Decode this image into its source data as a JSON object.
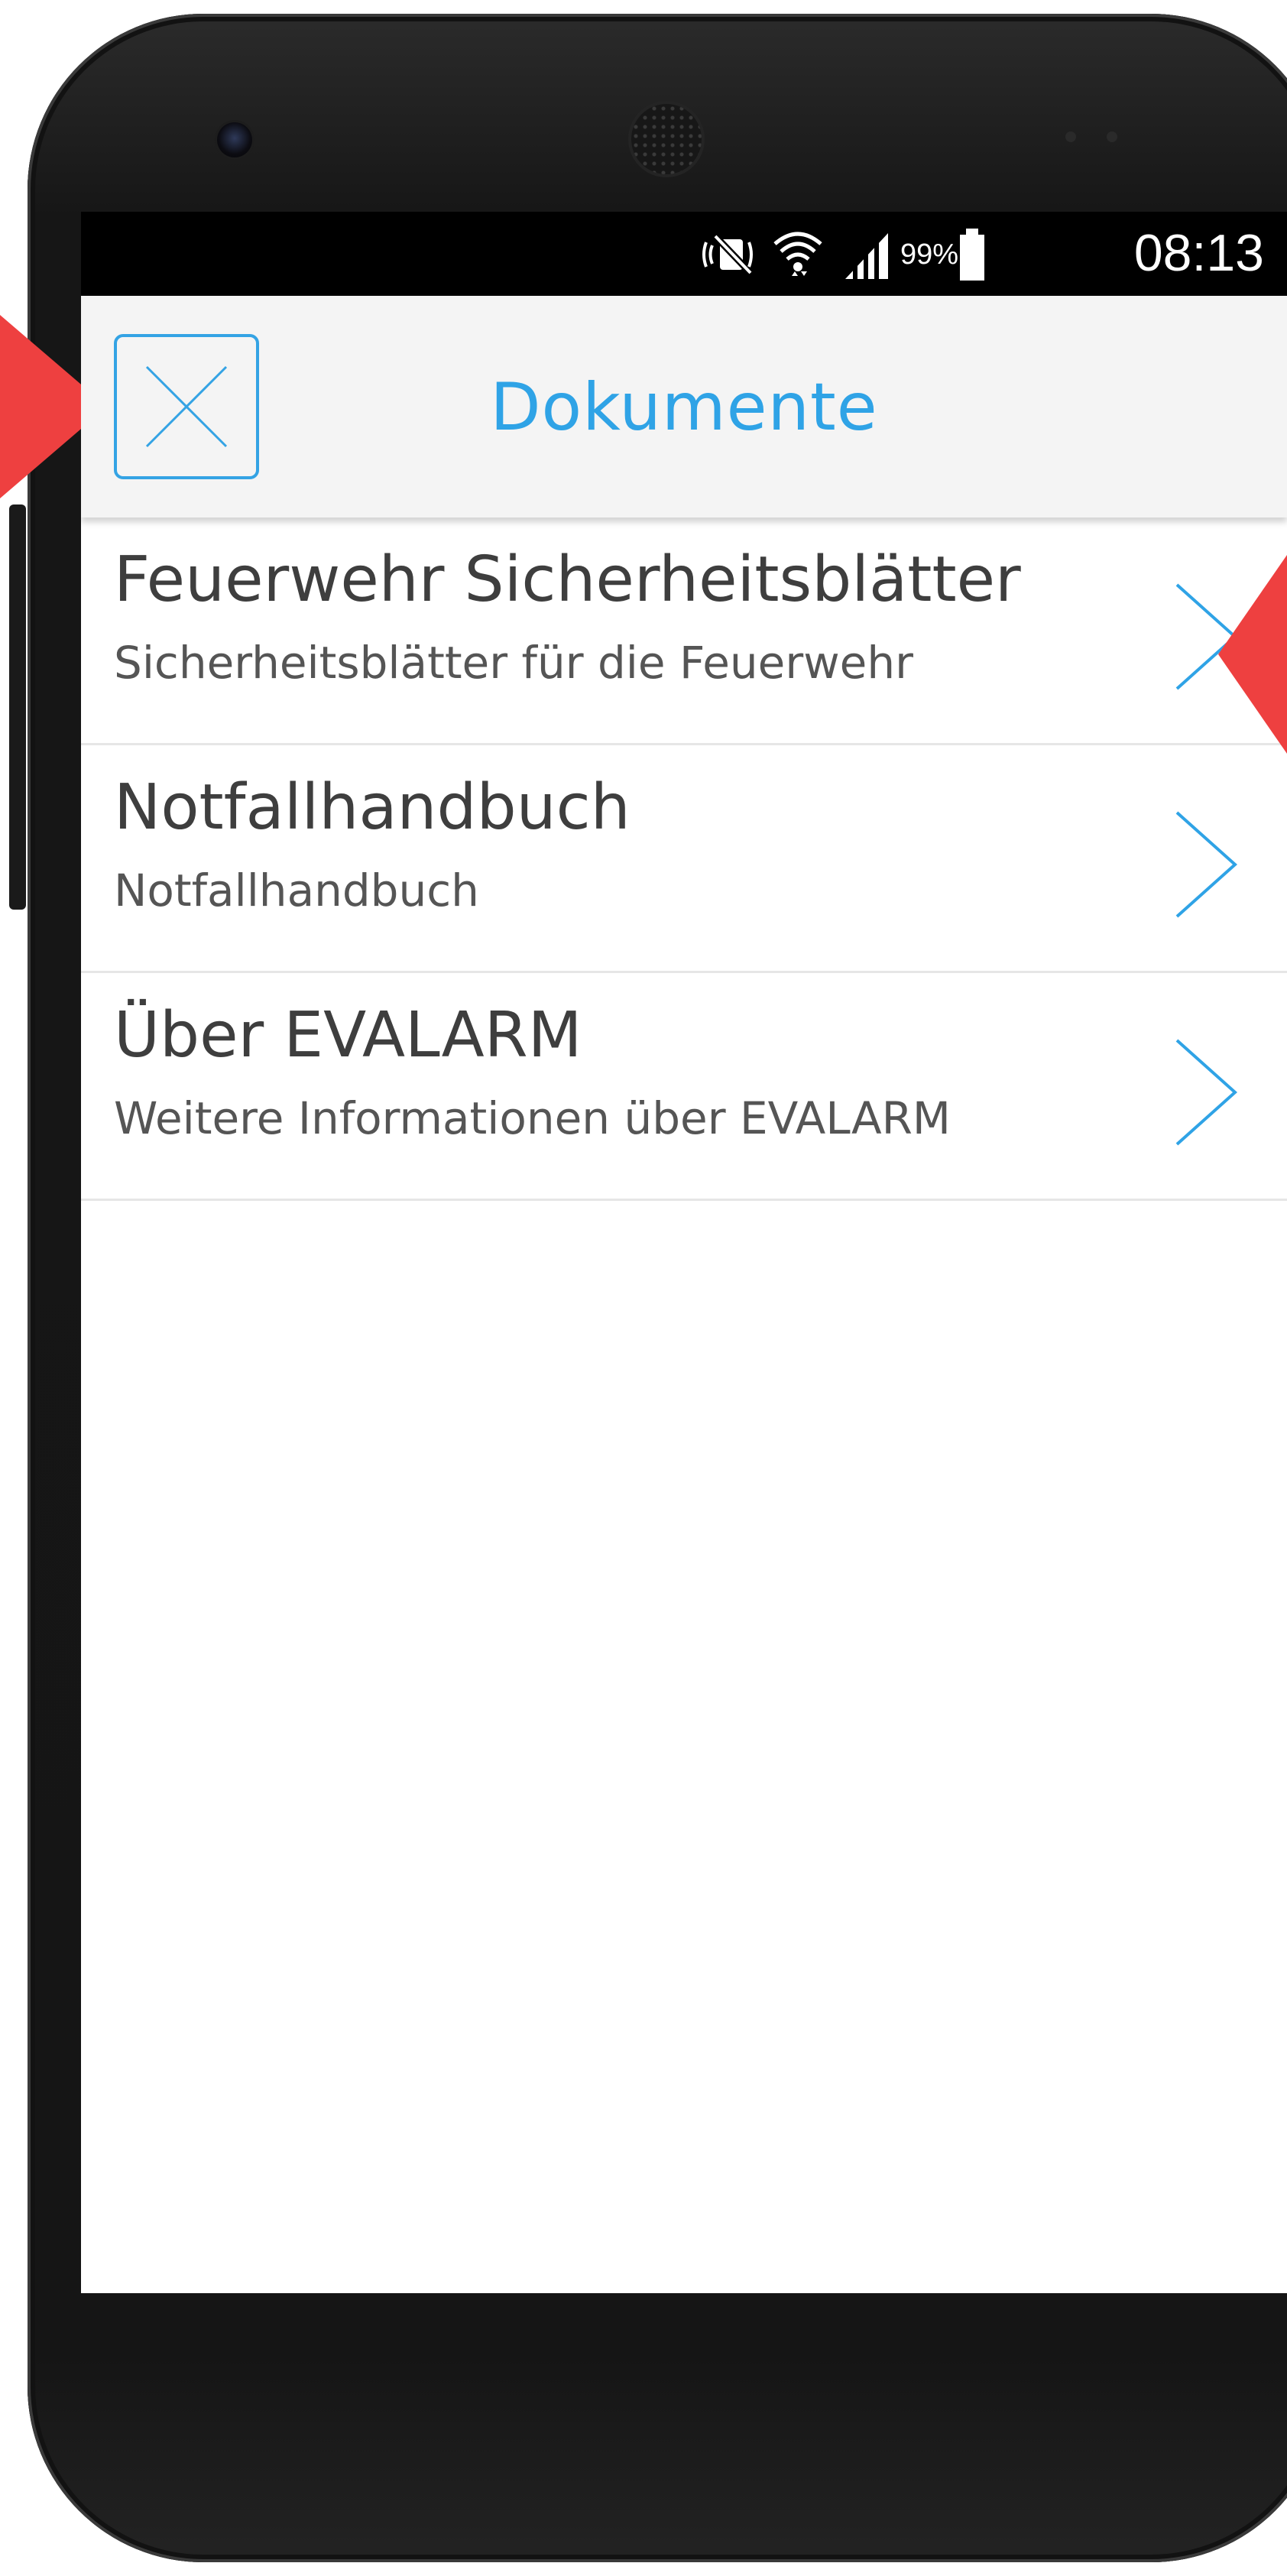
{
  "status_bar": {
    "battery_percent": "99%",
    "time": "08:13",
    "icons": [
      "silent-mode-icon",
      "wifi-icon",
      "signal-icon",
      "battery-icon"
    ]
  },
  "app_bar": {
    "title": "Dokumente",
    "close_icon": "close-icon",
    "accent_color": "#2fa3e6"
  },
  "items": [
    {
      "title": "Feuerwehr Sicherheitsblätter",
      "subtitle": "Sicherheitsblätter für die Feuerwehr"
    },
    {
      "title": "Notfallhandbuch",
      "subtitle": "Notfallhandbuch"
    },
    {
      "title": "Über EVALARM",
      "subtitle": "Weitere Informationen über EVALARM"
    }
  ],
  "annotation_color": "#ee4040"
}
